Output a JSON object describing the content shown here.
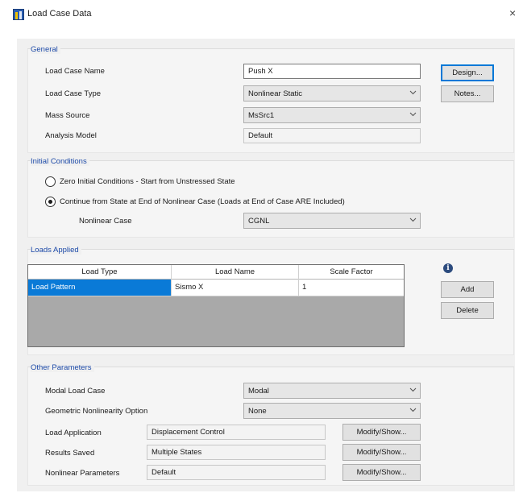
{
  "window": {
    "title": "Load Case Data",
    "close_glyph": "×"
  },
  "general": {
    "title": "General",
    "load_case_name_label": "Load Case Name",
    "load_case_name_value": "Push X",
    "load_case_type_label": "Load Case Type",
    "load_case_type_value": "Nonlinear Static",
    "mass_source_label": "Mass Source",
    "mass_source_value": "MsSrc1",
    "analysis_model_label": "Analysis Model",
    "analysis_model_value": "Default",
    "design_button": "Design...",
    "notes_button": "Notes..."
  },
  "initial_conditions": {
    "title": "Initial Conditions",
    "option_zero": "Zero Initial Conditions - Start from Unstressed State",
    "option_continue": "Continue from State at End of Nonlinear Case  (Loads at End of Case ARE Included)",
    "selected": "continue",
    "nonlinear_case_label": "Nonlinear Case",
    "nonlinear_case_value": "CGNL"
  },
  "loads_applied": {
    "title": "Loads Applied",
    "columns": [
      "Load Type",
      "Load Name",
      "Scale Factor"
    ],
    "rows": [
      {
        "load_type": "Load Pattern",
        "load_name": "Sismo X",
        "scale_factor": "1"
      }
    ],
    "info_icon": "i",
    "add_button": "Add",
    "delete_button": "Delete"
  },
  "other_parameters": {
    "title": "Other Parameters",
    "modal_load_case_label": "Modal Load Case",
    "modal_load_case_value": "Modal",
    "geometric_nonlinearity_label": "Geometric Nonlinearity Option",
    "geometric_nonlinearity_value": "None",
    "load_application_label": "Load Application",
    "load_application_value": "Displacement Control",
    "results_saved_label": "Results Saved",
    "results_saved_value": "Multiple States",
    "nonlinear_parameters_label": "Nonlinear Parameters",
    "nonlinear_parameters_value": "Default",
    "modify_show_button": "Modify/Show..."
  },
  "icons": {
    "app": "etabs-app-icon",
    "combo_arrow": "chevron-down-icon",
    "info": "info-icon"
  },
  "colors": {
    "group_title": "#1d4aa8",
    "selection": "#0a7ad7",
    "focus_border": "#0078d7",
    "grid_empty": "#a9a9a9"
  }
}
